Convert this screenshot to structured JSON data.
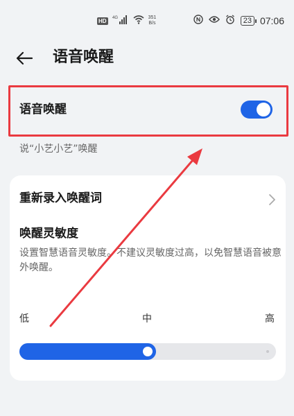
{
  "status_bar": {
    "hd": "HD",
    "signal": "4G",
    "net_speed_value": "351",
    "net_speed_unit": "B/s",
    "battery": "23",
    "time": "07:06",
    "icons": [
      "signal-icon",
      "wifi-icon",
      "nfc-icon",
      "eye-icon",
      "alarm-icon",
      "battery-icon"
    ]
  },
  "header": {
    "title": "语音唤醒"
  },
  "wakeup_toggle": {
    "label": "语音唤醒",
    "enabled": true,
    "subtitle": "说“小艺小艺”唤醒"
  },
  "rerecord": {
    "label": "重新录入唤醒词"
  },
  "sensitivity": {
    "title": "唤醒灵敏度",
    "description": "设置智慧语音灵敏度。不建议灵敏度过高，以免智慧语音被意外唤醒。",
    "levels": [
      "低",
      "中",
      "高"
    ],
    "value_percent": 50
  },
  "colors": {
    "accent": "#1f64e6",
    "annotation": "#ea3a40"
  }
}
